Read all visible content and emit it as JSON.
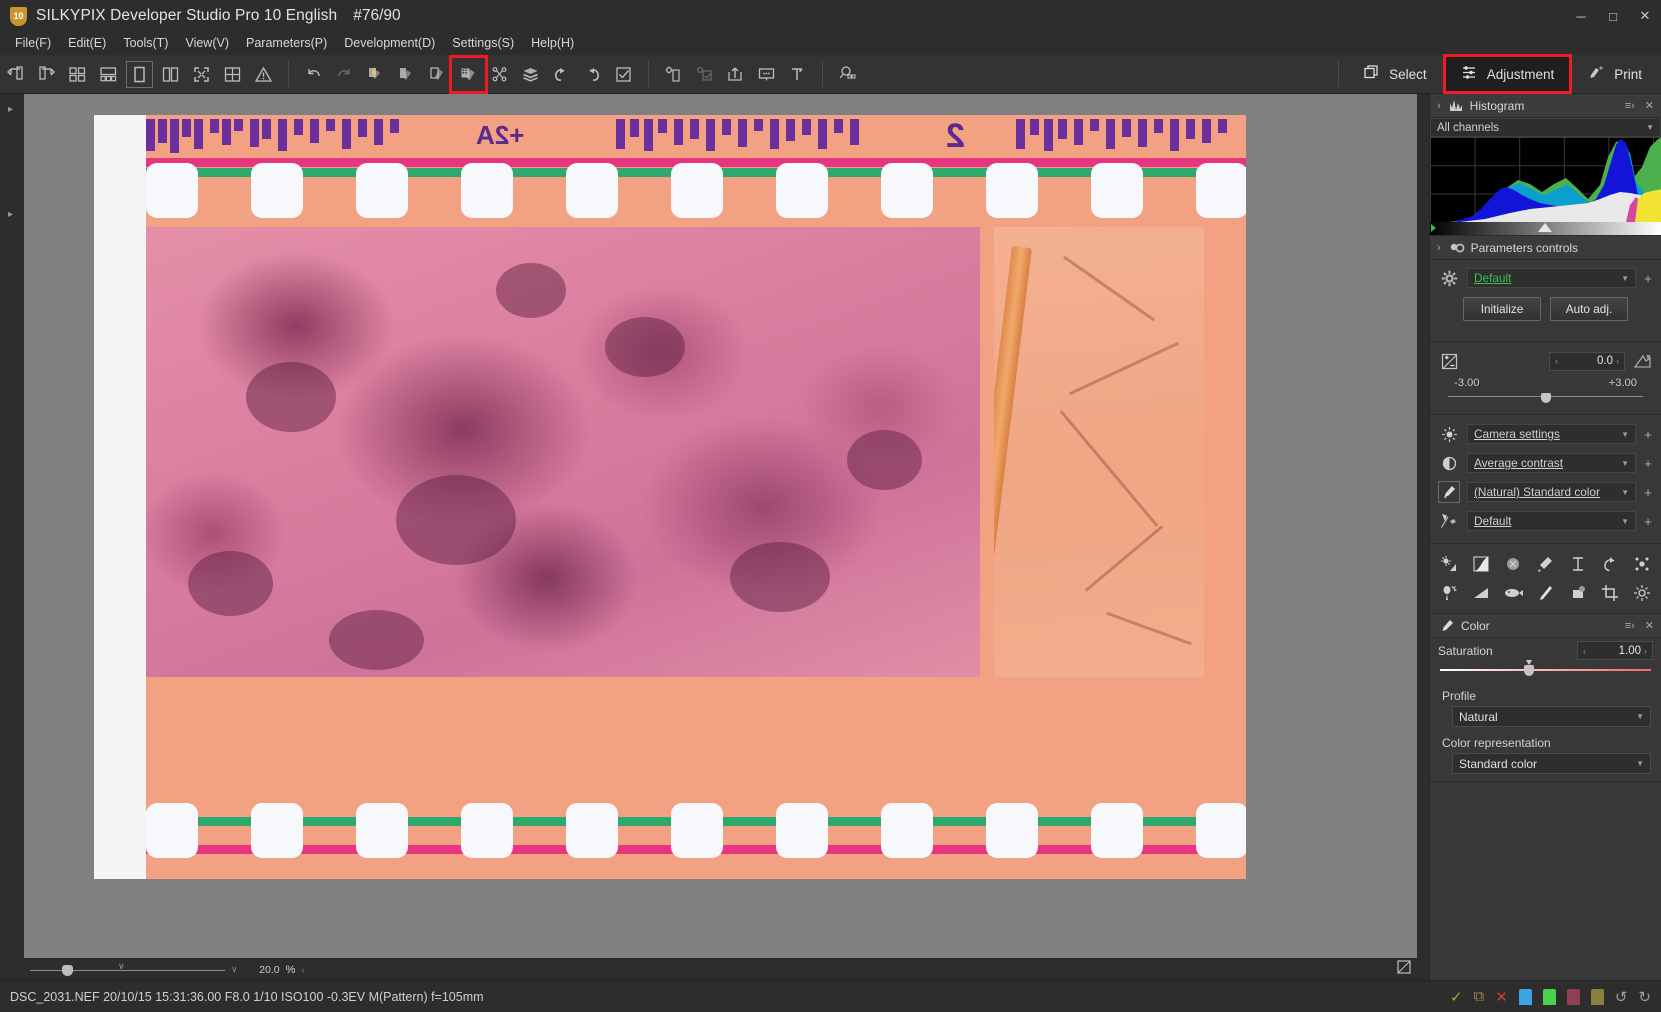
{
  "window": {
    "app_icon": "10",
    "title": "SILKYPIX Developer Studio Pro 10 English",
    "counter": "#76/90",
    "minimize": "─",
    "maximize": "□",
    "close": "✕"
  },
  "menubar": {
    "items": [
      {
        "label": "File(F)",
        "name": "menu-file"
      },
      {
        "label": "Edit(E)",
        "name": "menu-edit"
      },
      {
        "label": "Tools(T)",
        "name": "menu-tools"
      },
      {
        "label": "View(V)",
        "name": "menu-view"
      },
      {
        "label": "Parameters(P)",
        "name": "menu-parameters"
      },
      {
        "label": "Development(D)",
        "name": "menu-development"
      },
      {
        "label": "Settings(S)",
        "name": "menu-settings"
      },
      {
        "label": "Help(H)",
        "name": "menu-help"
      }
    ]
  },
  "toolbar": {
    "select_label": "Select",
    "adjustment_label": "Adjustment",
    "print_label": "Print",
    "highlight_color": "#ec1c24",
    "icons": [
      "rotate-left-icon",
      "rotate-right-icon",
      "thumbnail-grid-icon",
      "thumbnail-list-icon",
      "single-view-icon",
      "split-view-icon",
      "fullscreen-icon",
      "grid-overlay-icon",
      "warning-icon",
      "undo-icon",
      "redo-icon",
      "paste-params-icon",
      "copy-params-icon",
      "edit-params-icon",
      "taper-params-icon",
      "control-points-icon",
      "layers-icon",
      "rotate-ccw-icon",
      "rotate-cw-icon",
      "checkmark-box-icon",
      "batch-develop-icon",
      "batch-check-icon",
      "export-icon",
      "slideshow-icon",
      "crop-marker-icon",
      "magnifier-thumbnail-icon"
    ]
  },
  "histogram_panel": {
    "title": "Histogram",
    "expand_icon": "chevron-right-icon",
    "panel_icon": "histogram-icon",
    "menu_icon": "panel-menu-icon",
    "close_icon": "panel-close-icon",
    "channel_select": "All channels"
  },
  "parameters_panel": {
    "title": "Parameters controls",
    "expand_icon": "chevron-right-icon",
    "panel_icon": "parameters-icon",
    "taste": {
      "icon": "gear-icon",
      "value": "Default"
    },
    "initialize_label": "Initialize",
    "auto_adj_label": "Auto adj.",
    "exposure": {
      "icon": "exposure-bias-icon",
      "value": "0.0",
      "min_label": "-3.00",
      "max_label": "+3.00",
      "prev_caret": "‹",
      "next_caret": "›",
      "tail_icon": "exposure-reset-icon"
    },
    "rows": [
      {
        "icon": "white-balance-sun-icon",
        "label": "Camera settings",
        "name": "white-balance-row",
        "plus": "+"
      },
      {
        "icon": "contrast-icon",
        "label": "Average contrast",
        "name": "tone-row",
        "plus": "+"
      },
      {
        "icon": "color-brush-icon",
        "label": "(Natural) Standard color",
        "name": "color-row",
        "plus": "+",
        "boxed": true
      },
      {
        "icon": "sharpness-icon",
        "label": "Default",
        "name": "sharpness-row",
        "plus": "+"
      }
    ],
    "tool_icons_row1": [
      "exposure-tool-icon",
      "tone-curve-icon",
      "highlight-controller-icon",
      "color-tool-icon",
      "hsl-icon",
      "rotate-reset-icon",
      "noise-reduction-icon"
    ],
    "tool_icons_row2": [
      "dodge-burn-icon",
      "gradient-filter-icon",
      "lens-aberration-icon",
      "brush-tool-icon",
      "spot-removal-icon",
      "crop-icon",
      "fine-detail-icon"
    ]
  },
  "color_panel": {
    "title": "Color",
    "panel_icon": "color-brush-icon",
    "menu_icon": "panel-menu-icon",
    "close_icon": "panel-close-icon",
    "saturation": {
      "label": "Saturation",
      "value": "1.00",
      "prev_caret": "‹",
      "next_caret": "›"
    },
    "profile": {
      "label": "Profile",
      "value": "Natural"
    },
    "color_representation": {
      "label": "Color representation",
      "value": "Standard color"
    }
  },
  "zoombar": {
    "value": "20.0",
    "unit": "%",
    "prev_caret": "‹",
    "dropdown_caret": "∨",
    "fit_icon": "fit-to-window-icon"
  },
  "statusbar": {
    "info": "DSC_2031.NEF 20/10/15 15:31:36.00 F8.0 1/10 ISO100 -0.3EV M(Pattern) f=105mm",
    "icons": [
      {
        "name": "check-mark-icon",
        "glyph": "✓",
        "color": "#b79a43"
      },
      {
        "name": "copy-flag-icon",
        "glyph": "⧉",
        "color": "#9a8050"
      },
      {
        "name": "reject-icon",
        "glyph": "✕",
        "color": "#c6413a"
      },
      {
        "name": "tag-blue-icon",
        "glyph": "",
        "color": "#3aa5e0"
      },
      {
        "name": "tag-green-icon",
        "glyph": "",
        "color": "#4bd44b"
      },
      {
        "name": "tag-red-icon",
        "glyph": "",
        "color": "#8e4050"
      },
      {
        "name": "tag-olive-icon",
        "glyph": "",
        "color": "#8a8040"
      },
      {
        "name": "undo-history-icon",
        "glyph": "↺",
        "color": "#9d9d9d"
      },
      {
        "name": "redo-history-icon",
        "glyph": "↻",
        "color": "#9d9d9d"
      }
    ]
  },
  "photo": {
    "description": "Scanned color negative film strip, inverted colors, foliage frame",
    "reversed_text_top": "+2A",
    "reversed_digit": "2"
  }
}
